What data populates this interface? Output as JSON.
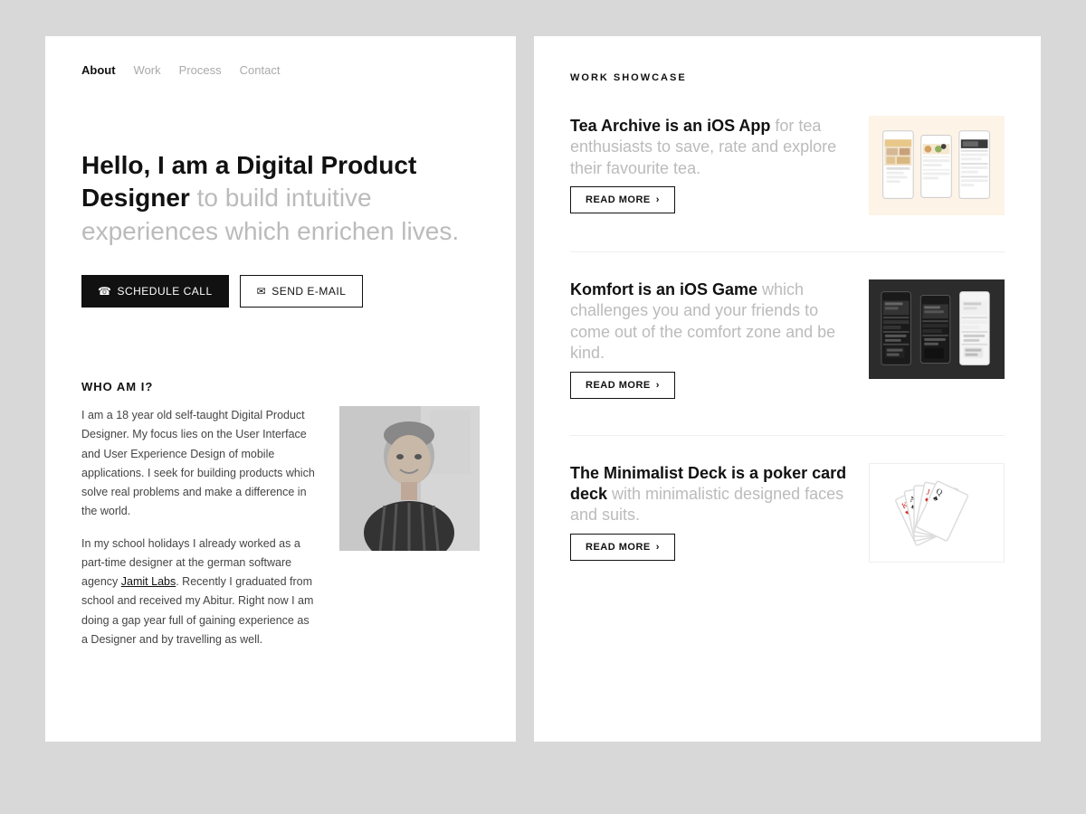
{
  "nav": {
    "items": [
      {
        "label": "About",
        "active": true
      },
      {
        "label": "Work",
        "active": false
      },
      {
        "label": "Process",
        "active": false
      },
      {
        "label": "Contact",
        "active": false
      }
    ]
  },
  "hero": {
    "title_bold": "Hello, I am a Digital Product Designer",
    "title_light": " to build intuitive experiences which enrichen lives.",
    "btn_schedule": "SCHEDULE CALL",
    "btn_email": "SEND E-MAIL"
  },
  "who": {
    "heading": "WHO AM I?",
    "para1": "I am a 18 year old self-taught Digital Product Designer. My focus lies on the User Interface and User Experience Design of mobile applications. I seek for building products which solve real problems and make a difference in the world.",
    "para2_before": "In my school holidays I already worked as a part-time designer at the german software agency ",
    "para2_link": "Jamit Labs",
    "para2_after": ". Recently I graduated from school and received my Abitur. Right now I am doing a gap year full of gaining experience as a Designer and by travelling as well."
  },
  "showcase": {
    "section_title": "WORK SHOWCASE",
    "projects": [
      {
        "id": "tea-archive",
        "title_bold": "Tea Archive is an iOS App",
        "title_light": " for tea enthusiasts to save, rate and explore their favourite tea.",
        "read_more": "READ MORE"
      },
      {
        "id": "komfort",
        "title_bold": "Komfort is an iOS Game",
        "title_light": " which challenges you and your friends to come out of the comfort zone and be kind.",
        "read_more": "READ MORE"
      },
      {
        "id": "minimalist-deck",
        "title_bold": "The Minimalist Deck is a poker card deck",
        "title_light": " with minimalistic designed faces and suits.",
        "read_more": "READ MORE"
      }
    ]
  },
  "icons": {
    "phone": "☎",
    "email": "✉",
    "arrow": "›"
  }
}
